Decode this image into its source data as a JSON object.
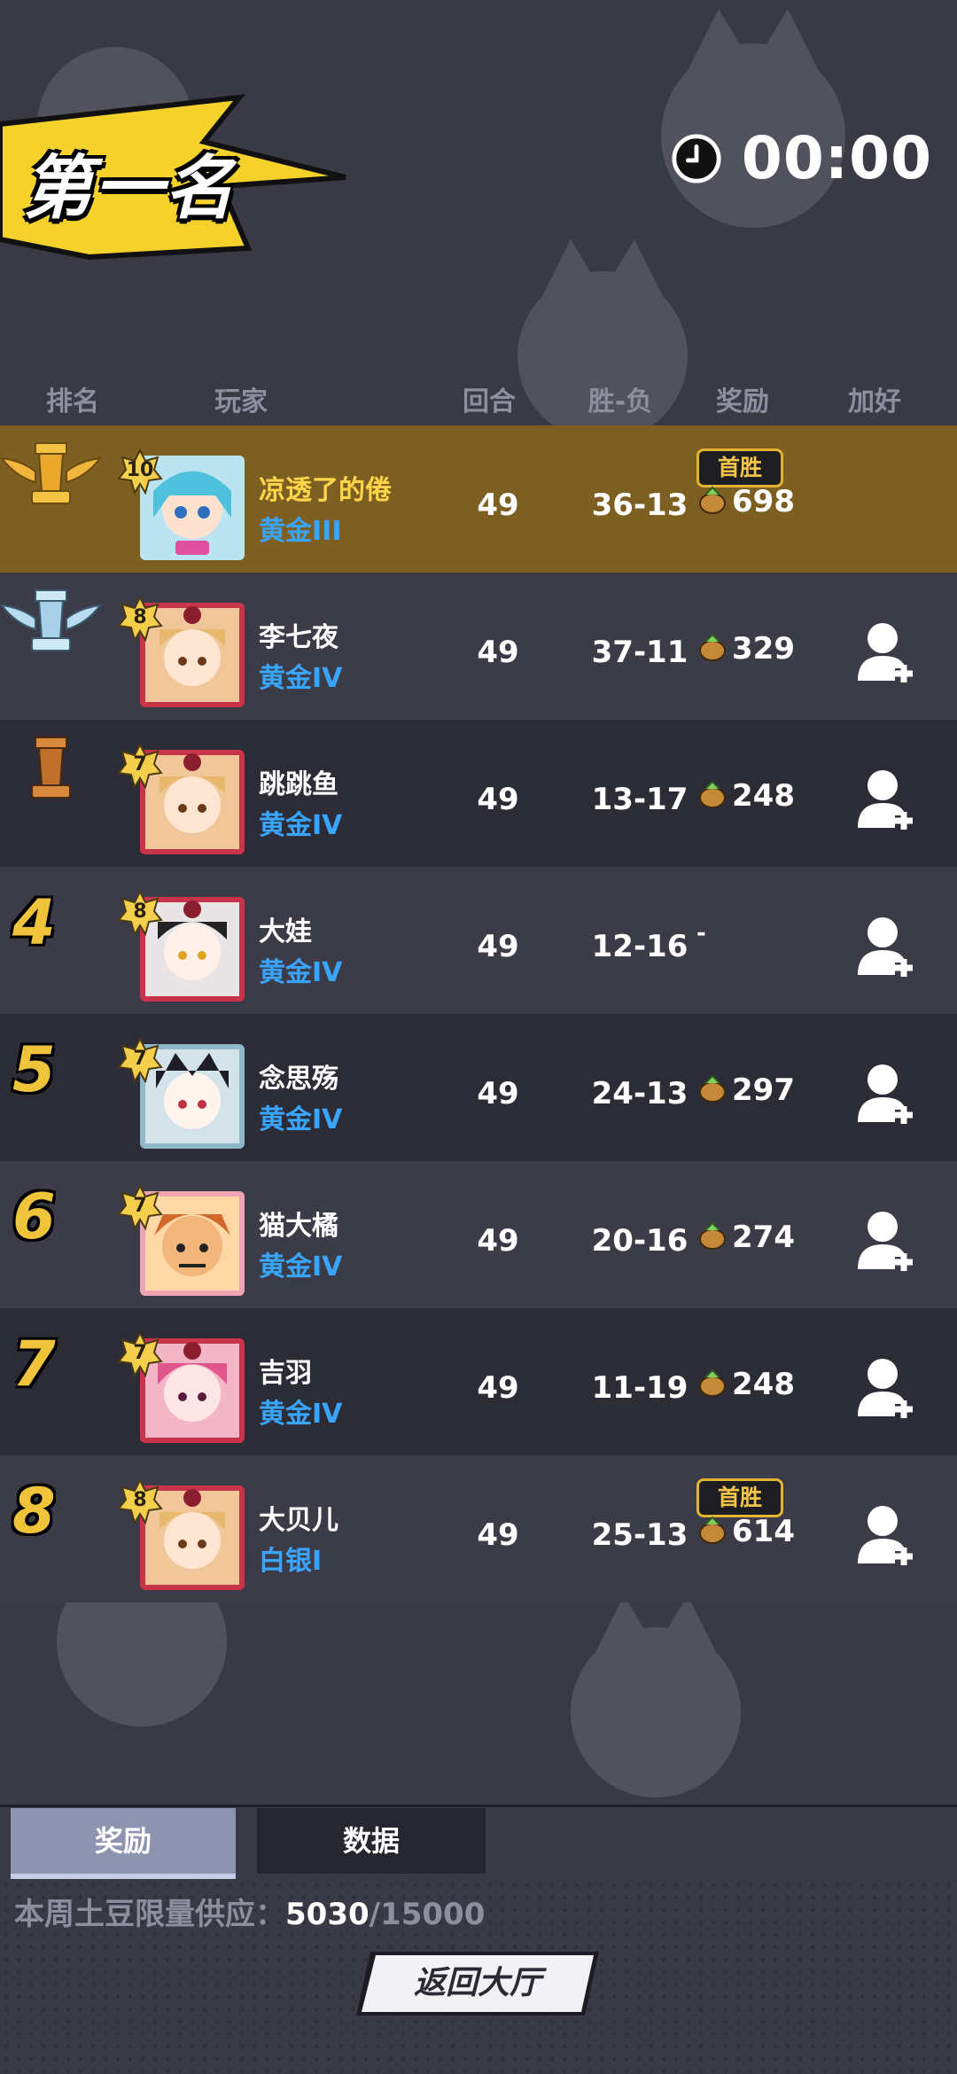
{
  "header": {
    "title": "第一名",
    "timer": "00:00"
  },
  "columns": {
    "rank": "排名",
    "player": "玩家",
    "rounds": "回合",
    "win_loss": "胜-负",
    "reward": "奖励",
    "add_friend": "加好友"
  },
  "rows": [
    {
      "rank": "1",
      "level": "10",
      "name": "凉透了的倦",
      "tier": "黄金III",
      "rounds": "49",
      "win_loss": "36-13",
      "reward": "698",
      "first_win": "首胜"
    },
    {
      "rank": "2",
      "level": "8",
      "name": "李七夜",
      "tier": "黄金IV",
      "rounds": "49",
      "win_loss": "37-11",
      "reward": "329"
    },
    {
      "rank": "3",
      "level": "7",
      "name": "跳跳鱼",
      "tier": "黄金IV",
      "rounds": "49",
      "win_loss": "13-17",
      "reward": "248"
    },
    {
      "rank": "4",
      "level": "8",
      "name": "大娃",
      "tier": "黄金IV",
      "rounds": "49",
      "win_loss": "12-16",
      "reward": "-"
    },
    {
      "rank": "5",
      "level": "7",
      "name": "念思殇",
      "tier": "黄金IV",
      "rounds": "49",
      "win_loss": "24-13",
      "reward": "297"
    },
    {
      "rank": "6",
      "level": "7",
      "name": "猫大橘",
      "tier": "黄金IV",
      "rounds": "49",
      "win_loss": "20-16",
      "reward": "274"
    },
    {
      "rank": "7",
      "level": "7",
      "name": "吉羽",
      "tier": "黄金IV",
      "rounds": "49",
      "win_loss": "11-19",
      "reward": "248"
    },
    {
      "rank": "8",
      "level": "8",
      "name": "大贝儿",
      "tier": "白银I",
      "rounds": "49",
      "win_loss": "25-13",
      "reward": "614",
      "first_win": "首胜"
    }
  ],
  "tabs": {
    "reward": "奖励",
    "data": "数据"
  },
  "supply": {
    "label": "本周土豆限量供应：",
    "current": "5030",
    "total": "/15000"
  },
  "back_button": "返回大厅",
  "colors": {
    "first_row": "#7d6021",
    "gold_text": "#f0c43a",
    "tier_blue": "#3aa5ff",
    "accent_yellow": "#f5d12b"
  }
}
